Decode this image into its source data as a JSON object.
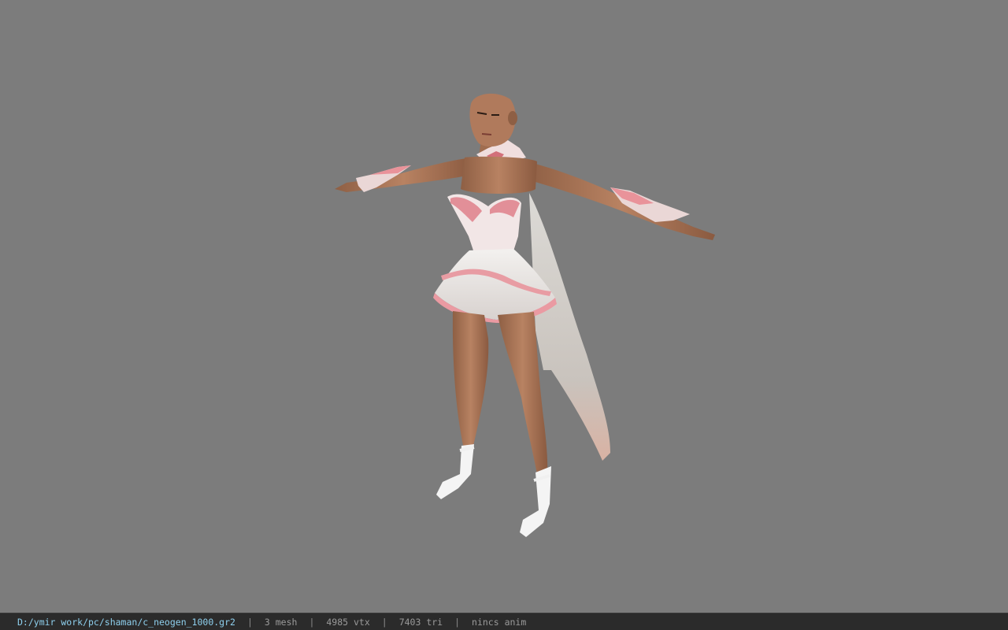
{
  "viewer": {
    "background_color": "#7c7c7c"
  },
  "model": {
    "icon": "character-model",
    "skin_color": "#b07a5c",
    "dress_color": "#ece8e6",
    "accent_color": "#e8959a"
  },
  "status_bar": {
    "file_path": "D:/ymir work/pc/shaman/c_neogen_1000.gr2",
    "separator": "|",
    "mesh_count": "3 mesh",
    "vertex_count": "4985 vtx",
    "triangle_count": "7403 tri",
    "anim_status": "nincs anim",
    "path_color": "#8ed0ee",
    "text_color": "#9a9a9a"
  }
}
